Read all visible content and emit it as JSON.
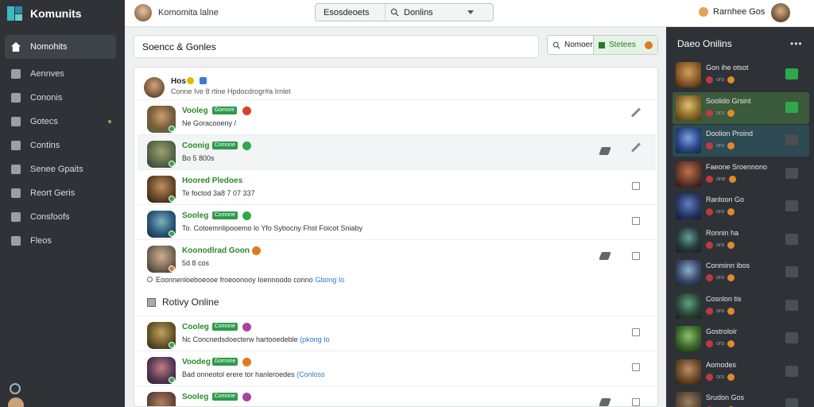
{
  "app": {
    "name": "Komunits"
  },
  "sidebar": {
    "items": [
      {
        "label": "Nomohits",
        "icon": "home-icon",
        "active": true
      },
      {
        "label": "Aennves",
        "icon": "activity-icon"
      },
      {
        "label": "Cononis",
        "icon": "book-icon"
      },
      {
        "label": "Gotecs",
        "icon": "games-icon",
        "dot": true
      },
      {
        "label": "Contins",
        "icon": "chat-icon"
      },
      {
        "label": "Senee Gpaits",
        "icon": "group-icon"
      },
      {
        "label": "Reort Geris",
        "icon": "report-icon"
      },
      {
        "label": "Consfoofs",
        "icon": "settings-icon"
      },
      {
        "label": "Fleos",
        "icon": "files-icon"
      }
    ]
  },
  "topbar": {
    "title": "Komomita lalne",
    "select_left": "Esosdeoets",
    "select_right": "Donlins",
    "user_name": "Rarnhee Gos"
  },
  "content": {
    "header_title": "Soencc & Gonles",
    "tool_name": "Nomoer",
    "tool_status": "Stetees"
  },
  "feed": {
    "head_name": "Hos",
    "head_sub": "Conne Ive 8 rtine Hpdocdrogr#a Irnlet",
    "rows": [
      {
        "name": "Vooleg",
        "badge": "Gomore",
        "game_color": "#d8402a",
        "text": "Ne Goracooeny /",
        "action": "feather",
        "avatar": [
          "#7a5c3a",
          "#c9a070",
          "#3d6a3d"
        ],
        "status_color": "#2ea84a"
      },
      {
        "name": "Coonig",
        "badge": "Comone",
        "game_color": "#2ea84a",
        "text": "Bo 5 800s",
        "action": "feather",
        "pin": true,
        "highlight": true,
        "avatar": [
          "#5a6a4a",
          "#a0a070",
          "#2a3a2a"
        ],
        "status_color": "#2ea84a"
      },
      {
        "name": "Hoored Pledoes",
        "badge": "",
        "game_color": "",
        "text": "Te foctod 3a8 7 07 337",
        "action": "box",
        "avatar": [
          "#6a4a2a",
          "#c09060",
          "#2a1a10"
        ],
        "status_color": "#2ea84a"
      },
      {
        "name": "Sooleg",
        "badge": "Comone",
        "game_color": "#2ea84a",
        "text": "To. Cotoemnlipooemo lo Yfo Sybocny Fhst Foicot Sniaby",
        "action": "box",
        "avatar": [
          "#2a5a7a",
          "#80b0c0",
          "#1a2a3a"
        ],
        "status_color": "#2ea84a"
      },
      {
        "name": "Koonodlrad Goon",
        "badge": "",
        "game_color": "#e07a20",
        "text": "5d 8 cos",
        "action": "box",
        "pin": true,
        "avatar": [
          "#7a6a5a",
          "#d0b090",
          "#3a2a20"
        ],
        "status_color": "#e07a20"
      }
    ],
    "note": "Eoonnenloeboeooe froeoonooy Ioennoodo conno",
    "note_link": "Gbong Io",
    "section_title": "Rotivy Online",
    "rows2": [
      {
        "name": "Cooleg",
        "badge": "Comone",
        "game_color": "#b040a0",
        "text": "Nc Concnedsdoecterw hartooedeble",
        "text_link": "(pkong Io",
        "action": "box",
        "avatar": [
          "#6a5a2a",
          "#c0a060",
          "#2a2010"
        ],
        "status_color": "#2ea84a"
      },
      {
        "name": "Voodeg",
        "badge": "Gomone",
        "game_color": "#e07a20",
        "text": "Bad onneotol erere tor hanleroedes",
        "text_link": "(Conloss",
        "action": "box",
        "avatar": [
          "#5a3a5a",
          "#c08080",
          "#2a1a20"
        ],
        "status_color": "#2ea84a"
      },
      {
        "name": "Sooleg",
        "badge": "Comone",
        "game_color": "#b040a0",
        "text": "",
        "text_link": "",
        "action": "box",
        "pin": true,
        "avatar": [
          "#6a4a3a",
          "#b08060",
          "#2a1a10"
        ],
        "status_color": "#2ea84a"
      }
    ]
  },
  "right_panel": {
    "title": "Daeo Onilins",
    "more": "•••",
    "items": [
      {
        "name": "Gon ihe otsot",
        "sub": "oro",
        "state": "",
        "check": "green",
        "avatar": [
          "#8a5a2a",
          "#d0a060",
          "#3a2010"
        ]
      },
      {
        "name": "Soolido Grsint",
        "sub": "oro",
        "state": "on",
        "check": "green",
        "avatar": [
          "#8a6a2a",
          "#e0c070",
          "#4a3010"
        ]
      },
      {
        "name": "Doolion Proind",
        "sub": "oro",
        "state": "sel",
        "check": "grey",
        "avatar": [
          "#2a4a8a",
          "#80a0e0",
          "#10203a"
        ]
      },
      {
        "name": "Faeone Sroennono",
        "sub": "one",
        "state": "",
        "check": "grey",
        "avatar": [
          "#6a3a2a",
          "#c07050",
          "#2a1010"
        ]
      },
      {
        "name": "Ranloon Go",
        "sub": "oro",
        "state": "",
        "check": "grey",
        "avatar": [
          "#2a3a6a",
          "#6080c0",
          "#10183a"
        ]
      },
      {
        "name": "Ronnin ha",
        "sub": "oro",
        "state": "",
        "check": "grey",
        "avatar": [
          "#2a3a3a",
          "#60a0a0",
          "#102020"
        ]
      },
      {
        "name": "Conminn ibos",
        "sub": "oro",
        "state": "",
        "check": "grey",
        "avatar": [
          "#3a4a6a",
          "#90b0d0",
          "#182030"
        ]
      },
      {
        "name": "Cosnlon tis",
        "sub": "oro",
        "state": "",
        "check": "grey",
        "avatar": [
          "#2a4a3a",
          "#60a080",
          "#10201a"
        ]
      },
      {
        "name": "Gostroloir",
        "sub": "oro",
        "state": "",
        "check": "grey",
        "avatar": [
          "#3a6a2a",
          "#90c070",
          "#1a3010"
        ]
      },
      {
        "name": "Aomodes",
        "sub": "oro",
        "state": "",
        "check": "grey",
        "avatar": [
          "#6a4a2a",
          "#c09060",
          "#2a1a10"
        ]
      },
      {
        "name": "Srudon Gos",
        "sub": "oro",
        "state": "",
        "check": "grey",
        "avatar": [
          "#5a4a3a",
          "#a08060",
          "#2a2010"
        ]
      }
    ]
  }
}
